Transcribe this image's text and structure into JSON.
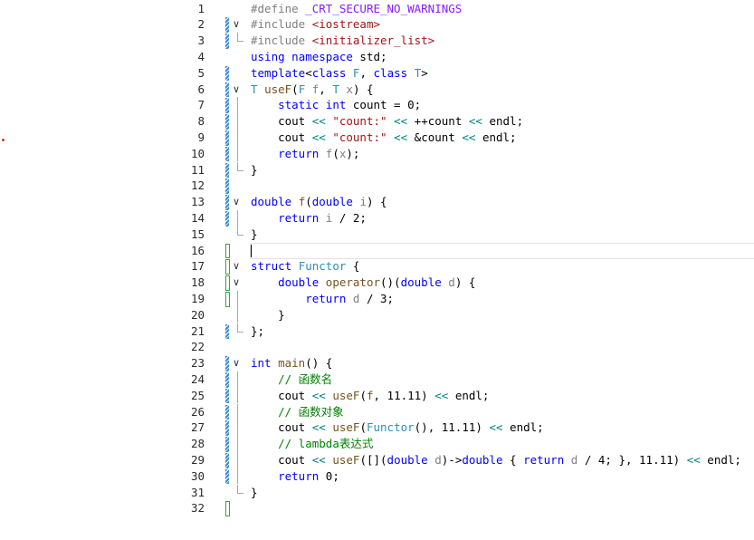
{
  "editor": {
    "first_line_number": 1,
    "current_line": 16,
    "lines": [
      {
        "n": 1,
        "marker": "",
        "fold": "",
        "tokens": [
          [
            "pp",
            "#define "
          ],
          [
            "mac",
            "_CRT_SECURE_NO_WARNINGS"
          ]
        ]
      },
      {
        "n": 2,
        "marker": "hatch",
        "fold": "open",
        "tokens": [
          [
            "pp",
            "#include "
          ],
          [
            "inc",
            "<iostream>"
          ]
        ]
      },
      {
        "n": 3,
        "marker": "hatch",
        "fold": "end",
        "tokens": [
          [
            "pp",
            "#include "
          ],
          [
            "inc",
            "<initializer_list>"
          ]
        ]
      },
      {
        "n": 4,
        "marker": "",
        "fold": "",
        "tokens": [
          [
            "kw",
            "using"
          ],
          [
            "",
            " "
          ],
          [
            "kw",
            "namespace"
          ],
          [
            "",
            " std;"
          ]
        ]
      },
      {
        "n": 5,
        "marker": "hatch",
        "fold": "",
        "tokens": [
          [
            "kw",
            "template"
          ],
          [
            "",
            "<"
          ],
          [
            "kw",
            "class"
          ],
          [
            "",
            " "
          ],
          [
            "ty",
            "F"
          ],
          [
            "",
            ", "
          ],
          [
            "kw",
            "class"
          ],
          [
            "",
            " "
          ],
          [
            "ty",
            "T"
          ],
          [
            "",
            ">"
          ]
        ]
      },
      {
        "n": 6,
        "marker": "hatch",
        "fold": "open",
        "tokens": [
          [
            "ty",
            "T"
          ],
          [
            "",
            " "
          ],
          [
            "fn",
            "useF"
          ],
          [
            "",
            "("
          ],
          [
            "ty",
            "F"
          ],
          [
            "",
            " "
          ],
          [
            "par",
            "f"
          ],
          [
            "",
            ", "
          ],
          [
            "ty",
            "T"
          ],
          [
            "",
            " "
          ],
          [
            "par",
            "x"
          ],
          [
            "",
            ") {"
          ]
        ]
      },
      {
        "n": 7,
        "marker": "hatch",
        "fold": "line",
        "tokens": [
          [
            "",
            "    "
          ],
          [
            "kw",
            "static"
          ],
          [
            "",
            " "
          ],
          [
            "kw",
            "int"
          ],
          [
            "",
            " count = 0;"
          ]
        ]
      },
      {
        "n": 8,
        "marker": "hatch",
        "fold": "line",
        "tokens": [
          [
            "",
            "    cout "
          ],
          [
            "op",
            "<<"
          ],
          [
            "",
            " "
          ],
          [
            "str",
            "\"count:\""
          ],
          [
            "",
            " "
          ],
          [
            "op",
            "<<"
          ],
          [
            "",
            " ++count "
          ],
          [
            "op",
            "<<"
          ],
          [
            "",
            " endl;"
          ]
        ]
      },
      {
        "n": 9,
        "marker": "hatch",
        "fold": "line",
        "tokens": [
          [
            "",
            "    cout "
          ],
          [
            "op",
            "<<"
          ],
          [
            "",
            " "
          ],
          [
            "str",
            "\"count:\""
          ],
          [
            "",
            " "
          ],
          [
            "op",
            "<<"
          ],
          [
            "",
            " &count "
          ],
          [
            "op",
            "<<"
          ],
          [
            "",
            " endl;"
          ]
        ]
      },
      {
        "n": 10,
        "marker": "hatch",
        "fold": "line",
        "tokens": [
          [
            "",
            "    "
          ],
          [
            "kw",
            "return"
          ],
          [
            "",
            " "
          ],
          [
            "par",
            "f"
          ],
          [
            "",
            "("
          ],
          [
            "par",
            "x"
          ],
          [
            "",
            ");"
          ]
        ]
      },
      {
        "n": 11,
        "marker": "hatch",
        "fold": "end",
        "tokens": [
          [
            "",
            "}"
          ]
        ]
      },
      {
        "n": 12,
        "marker": "hatch",
        "fold": "",
        "tokens": []
      },
      {
        "n": 13,
        "marker": "hatch",
        "fold": "open",
        "tokens": [
          [
            "kw",
            "double"
          ],
          [
            "",
            " "
          ],
          [
            "fn",
            "f"
          ],
          [
            "",
            "("
          ],
          [
            "kw",
            "double"
          ],
          [
            "",
            " "
          ],
          [
            "par",
            "i"
          ],
          [
            "",
            ") {"
          ]
        ]
      },
      {
        "n": 14,
        "marker": "hatch",
        "fold": "line",
        "tokens": [
          [
            "",
            "    "
          ],
          [
            "kw",
            "return"
          ],
          [
            "",
            " "
          ],
          [
            "par",
            "i"
          ],
          [
            "",
            " / 2;"
          ]
        ]
      },
      {
        "n": 15,
        "marker": "",
        "fold": "end",
        "tokens": [
          [
            "",
            "}"
          ]
        ]
      },
      {
        "n": 16,
        "marker": "green",
        "fold": "",
        "tokens": []
      },
      {
        "n": 17,
        "marker": "green",
        "fold": "open",
        "tokens": [
          [
            "kw",
            "struct"
          ],
          [
            "",
            " "
          ],
          [
            "ty",
            "Functor"
          ],
          [
            "",
            " {"
          ]
        ]
      },
      {
        "n": 18,
        "marker": "green",
        "fold": "open2",
        "tokens": [
          [
            "",
            "    "
          ],
          [
            "kw",
            "double"
          ],
          [
            "",
            " "
          ],
          [
            "fn",
            "operator"
          ],
          [
            "",
            "()("
          ],
          [
            "kw",
            "double"
          ],
          [
            "",
            " "
          ],
          [
            "par",
            "d"
          ],
          [
            "",
            ") {"
          ]
        ]
      },
      {
        "n": 19,
        "marker": "green",
        "fold": "line",
        "tokens": [
          [
            "",
            "        "
          ],
          [
            "kw",
            "return"
          ],
          [
            "",
            " "
          ],
          [
            "par",
            "d"
          ],
          [
            "",
            " / 3;"
          ]
        ]
      },
      {
        "n": 20,
        "marker": "",
        "fold": "line",
        "tokens": [
          [
            "",
            "    }"
          ]
        ]
      },
      {
        "n": 21,
        "marker": "hatch",
        "fold": "end",
        "tokens": [
          [
            "",
            "};"
          ]
        ]
      },
      {
        "n": 22,
        "marker": "",
        "fold": "",
        "tokens": []
      },
      {
        "n": 23,
        "marker": "hatch",
        "fold": "open",
        "tokens": [
          [
            "kw",
            "int"
          ],
          [
            "",
            " "
          ],
          [
            "fn",
            "main"
          ],
          [
            "",
            "() {"
          ]
        ]
      },
      {
        "n": 24,
        "marker": "hatch",
        "fold": "line",
        "tokens": [
          [
            "",
            "    "
          ],
          [
            "cmt",
            "// 函数名"
          ]
        ]
      },
      {
        "n": 25,
        "marker": "hatch",
        "fold": "line",
        "tokens": [
          [
            "",
            "    cout "
          ],
          [
            "op",
            "<<"
          ],
          [
            "",
            " "
          ],
          [
            "fn",
            "useF"
          ],
          [
            "",
            "("
          ],
          [
            "fn",
            "f"
          ],
          [
            "",
            ", 11.11) "
          ],
          [
            "op",
            "<<"
          ],
          [
            "",
            " endl;"
          ]
        ]
      },
      {
        "n": 26,
        "marker": "hatch",
        "fold": "line",
        "tokens": [
          [
            "",
            "    "
          ],
          [
            "cmt",
            "// 函数对象"
          ]
        ]
      },
      {
        "n": 27,
        "marker": "hatch",
        "fold": "line",
        "tokens": [
          [
            "",
            "    cout "
          ],
          [
            "op",
            "<<"
          ],
          [
            "",
            " "
          ],
          [
            "fn",
            "useF"
          ],
          [
            "",
            "("
          ],
          [
            "ty",
            "Functor"
          ],
          [
            "",
            "(), 11.11) "
          ],
          [
            "op",
            "<<"
          ],
          [
            "",
            " endl;"
          ]
        ]
      },
      {
        "n": 28,
        "marker": "hatch",
        "fold": "line",
        "tokens": [
          [
            "",
            "    "
          ],
          [
            "cmt",
            "// lambda表达式"
          ]
        ]
      },
      {
        "n": 29,
        "marker": "hatch",
        "fold": "line",
        "tokens": [
          [
            "",
            "    cout "
          ],
          [
            "op",
            "<<"
          ],
          [
            "",
            " "
          ],
          [
            "fn",
            "useF"
          ],
          [
            "",
            "([]("
          ],
          [
            "kw",
            "double"
          ],
          [
            "",
            " "
          ],
          [
            "par",
            "d"
          ],
          [
            "",
            ")->"
          ],
          [
            "kw",
            "double"
          ],
          [
            "",
            " { "
          ],
          [
            "kw",
            "return"
          ],
          [
            "",
            " "
          ],
          [
            "par",
            "d"
          ],
          [
            "",
            " / 4; }, 11.11) "
          ],
          [
            "op",
            "<<"
          ],
          [
            "",
            " endl;"
          ]
        ]
      },
      {
        "n": 30,
        "marker": "hatch",
        "fold": "line",
        "tokens": [
          [
            "",
            "    "
          ],
          [
            "kw",
            "return"
          ],
          [
            "",
            " 0;"
          ]
        ]
      },
      {
        "n": 31,
        "marker": "",
        "fold": "end",
        "tokens": [
          [
            "",
            "}"
          ]
        ]
      },
      {
        "n": 32,
        "marker": "green",
        "fold": "",
        "tokens": []
      }
    ]
  },
  "colors": {
    "keyword": "#0000ff",
    "type": "#2b91af",
    "string": "#a31515",
    "comment": "#008000",
    "macro": "#8a1bff",
    "change_saved": "#3aa53a",
    "change_unsaved": "#3c8dd8"
  }
}
